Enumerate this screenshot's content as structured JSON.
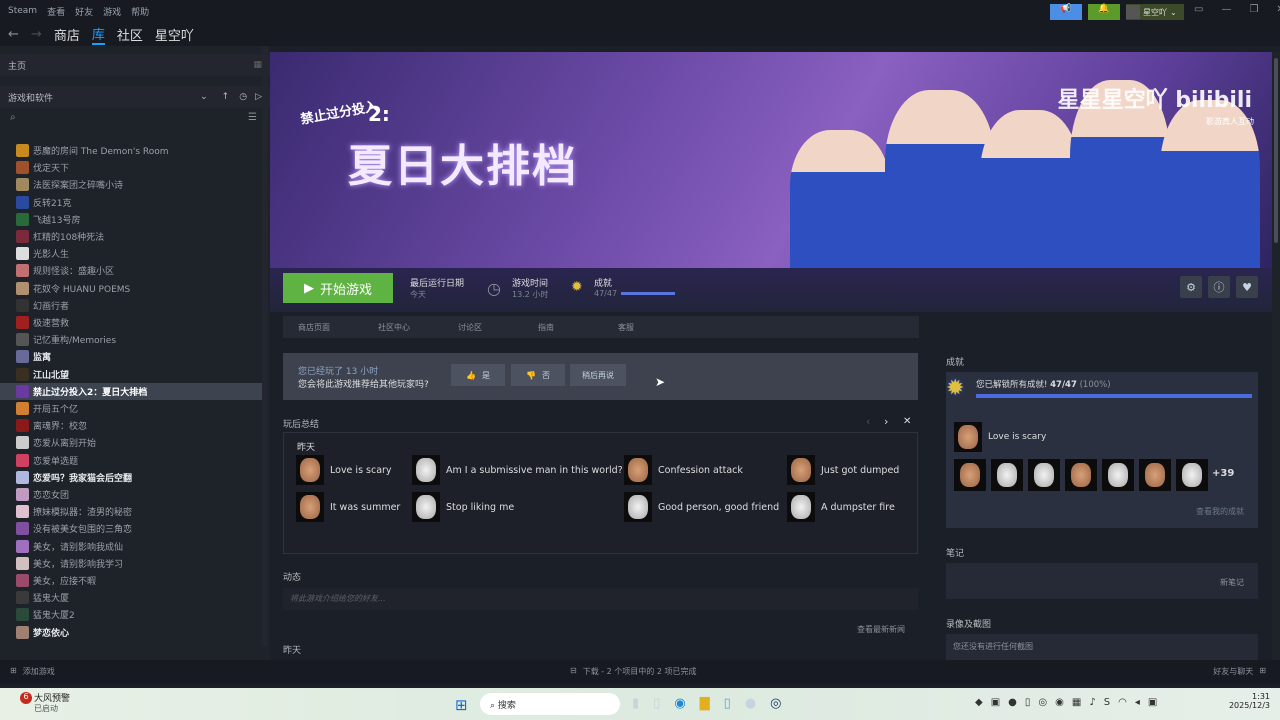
{
  "menu": {
    "steam": "Steam",
    "items": [
      "查看",
      "好友",
      "游戏",
      "帮助"
    ]
  },
  "nav": {
    "tabs": [
      "商店",
      "库",
      "社区",
      "星空吖"
    ],
    "active": 1
  },
  "account": {
    "name": "星空吖"
  },
  "sidebar": {
    "home": "主页",
    "filter": "游戏和软件",
    "games": [
      {
        "name": "恶魔的房间 The Demon's Room",
        "color": "#c68a20"
      },
      {
        "name": "伐定天下",
        "color": "#a0502a"
      },
      {
        "name": "法医探案团之碎嘴小诗",
        "color": "#a08860"
      },
      {
        "name": "反转21克",
        "color": "#2a4aa0"
      },
      {
        "name": "飞越13号房",
        "color": "#2a6a3a"
      },
      {
        "name": "杠精的108种死法",
        "color": "#7a2a3a"
      },
      {
        "name": "光影人生",
        "color": "#ddd"
      },
      {
        "name": "规则怪谈：盛趣小区",
        "color": "#c07070"
      },
      {
        "name": "花奴令 HUANU POEMS",
        "color": "#b09070"
      },
      {
        "name": "幻画行者",
        "color": "#333"
      },
      {
        "name": "极速营救",
        "color": "#a02020"
      },
      {
        "name": "记忆重构/Memories",
        "color": "#555"
      },
      {
        "name": "监寓",
        "color": "#6a6a9a",
        "inst": true
      },
      {
        "name": "江山北望",
        "color": "#3a3020",
        "inst": true
      },
      {
        "name": "禁止过分投入2：夏日大排档",
        "color": "#6a3aa0",
        "sel": true
      },
      {
        "name": "开局五个亿",
        "color": "#d08030"
      },
      {
        "name": "离魂界：校忽",
        "color": "#8a1a1a"
      },
      {
        "name": "恋爱从离别开始",
        "color": "#ccc"
      },
      {
        "name": "恋爱单选题",
        "color": "#d04060"
      },
      {
        "name": "恋爱吗？我家猫会后空翻",
        "color": "#b0b8e0",
        "inst": true
      },
      {
        "name": "恋恋女团",
        "color": "#c09ac0"
      },
      {
        "name": "撩妹模拟器：渣男的秘密",
        "color": "#e0c0d0"
      },
      {
        "name": "没有被美女包围的三角恋",
        "color": "#8050a0"
      },
      {
        "name": "美女，请别影响我成仙",
        "color": "#a070c0"
      },
      {
        "name": "美女，请别影响我学习",
        "color": "#d0c0c0"
      },
      {
        "name": "美女，应接不暇",
        "color": "#9a4a6a"
      },
      {
        "name": "猛鬼大厦",
        "color": "#3a3a3a"
      },
      {
        "name": "猛鬼大厦2",
        "color": "#2a4a3a"
      },
      {
        "name": "梦恋依心",
        "color": "#a08070",
        "inst": true
      }
    ],
    "add_game": "添加游戏"
  },
  "hero": {
    "logo_small": "禁止过分投入",
    "logo_num": "2:",
    "logo_main": "夏日大排档",
    "watermark": "星星星空吖 bilibili",
    "watermark_sub": "影游真人互动"
  },
  "actions": {
    "play": "开始游戏",
    "last_played_label": "最后运行日期",
    "last_played": "今天",
    "playtime_label": "游戏时间",
    "playtime": "13.2 小时",
    "ach_label": "成就",
    "ach_value": "47/47",
    "ach_progress": 1.0
  },
  "tabs": [
    "商店页面",
    "社区中心",
    "讨论区",
    "指南",
    "客服"
  ],
  "recommend": {
    "line1": "您已经玩了 13 小时",
    "line2": "您会将此游戏推荐给其他玩家吗?",
    "yes": "是",
    "no": "否",
    "later": "稍后再说"
  },
  "recap": {
    "title": "玩后总结",
    "day": "昨天",
    "items": [
      {
        "name": "Love is scary",
        "tier": "bronze"
      },
      {
        "name": "Am I a submissive man in this world?",
        "tier": "silver"
      },
      {
        "name": "Confession attack",
        "tier": "bronze"
      },
      {
        "name": "Just got dumped",
        "tier": "bronze"
      },
      {
        "name": "It was summer",
        "tier": "bronze"
      },
      {
        "name": "Stop liking me",
        "tier": "silver"
      },
      {
        "name": "Good person, good friend",
        "tier": "silver"
      },
      {
        "name": "A dumpster fire",
        "tier": "silver"
      }
    ]
  },
  "activity": {
    "title": "动态",
    "placeholder": "将此游戏介绍给您的好友...",
    "news": "查看最新新闻",
    "day": "昨天"
  },
  "achievements": {
    "title": "成就",
    "unlocked": "您已解锁所有成就!",
    "count": "47/47",
    "pct": "(100%)",
    "progress": 1.0,
    "latest": "Love is scary",
    "tiers": [
      "bronze",
      "silver",
      "silver",
      "bronze",
      "silver",
      "bronze",
      "silver"
    ],
    "more": "+39",
    "view": "查看我的成就"
  },
  "notes": {
    "title": "笔记",
    "new": "新笔记"
  },
  "screenshots": {
    "title": "录像及截图",
    "empty": "您还没有进行任何截图"
  },
  "status": {
    "downloads": "下载 - 2 个项目中的 2 项已完成",
    "friends": "好友与聊天"
  },
  "taskbar": {
    "weather_badge": "6",
    "weather": "大风预警",
    "weather_sub": "已启动",
    "search": "搜索",
    "time": "1:31",
    "date": "2025/12/3"
  }
}
